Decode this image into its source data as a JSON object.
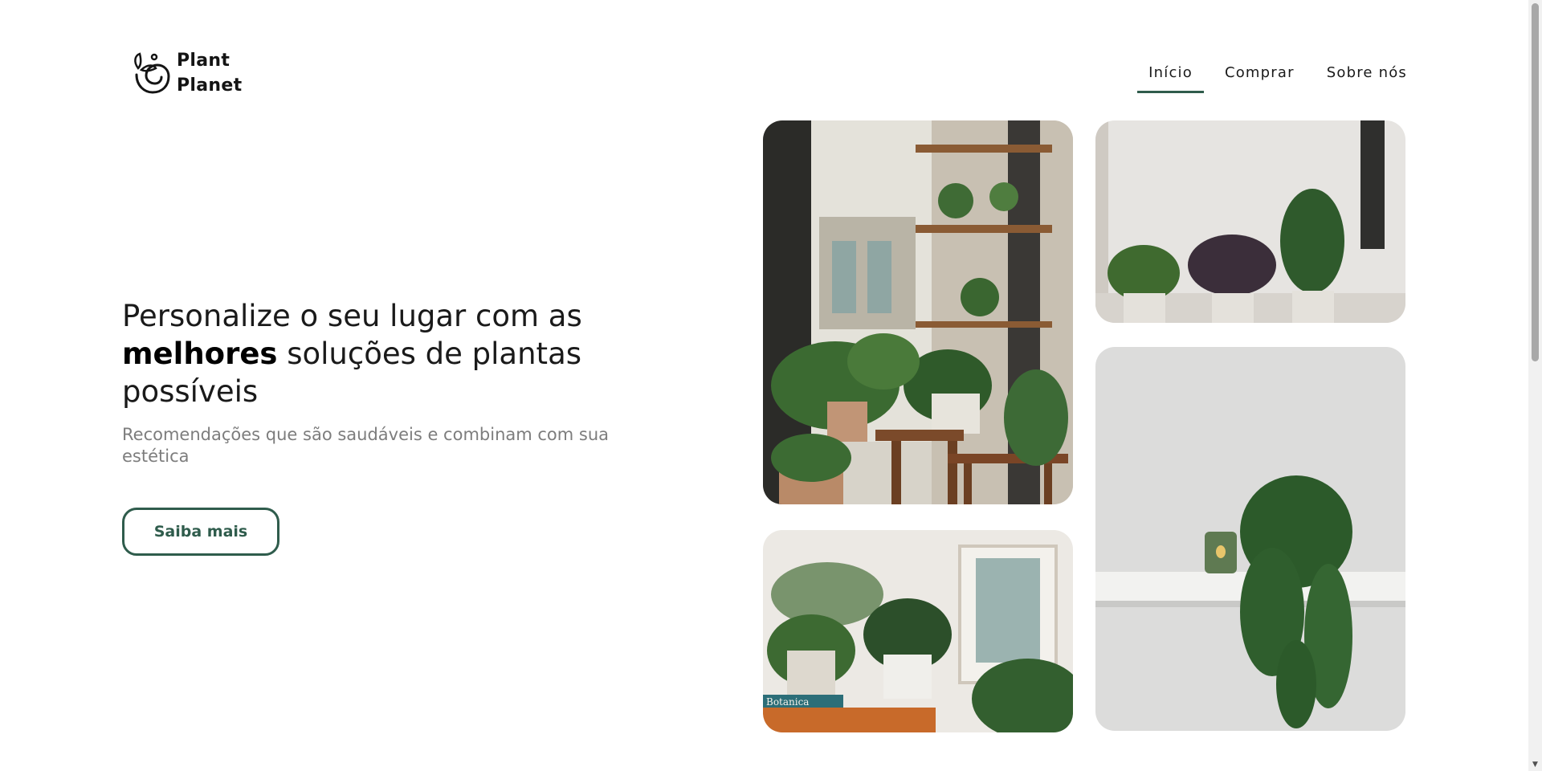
{
  "brand": {
    "line1": "Plant",
    "line2": "Planet",
    "logo_icon": "leaf-bowl-icon"
  },
  "nav": {
    "items": [
      {
        "label": "Início",
        "active": true
      },
      {
        "label": "Comprar",
        "active": false
      },
      {
        "label": "Sobre nós",
        "active": false
      }
    ]
  },
  "hero": {
    "title_part1": "Personalize o seu lugar com as",
    "title_bold": "melhores",
    "title_part2": " soluções de plantas possíveis",
    "subtitle": "Recomendações que são saudáveis e combinam com sua estética",
    "cta_label": "Saiba mais"
  },
  "gallery": {
    "photo4_book_label": "Botanica"
  },
  "colors": {
    "accent": "#2f5c4c",
    "text": "#1a1a1a",
    "muted": "#7d7d7d",
    "background": "#ffffff"
  }
}
